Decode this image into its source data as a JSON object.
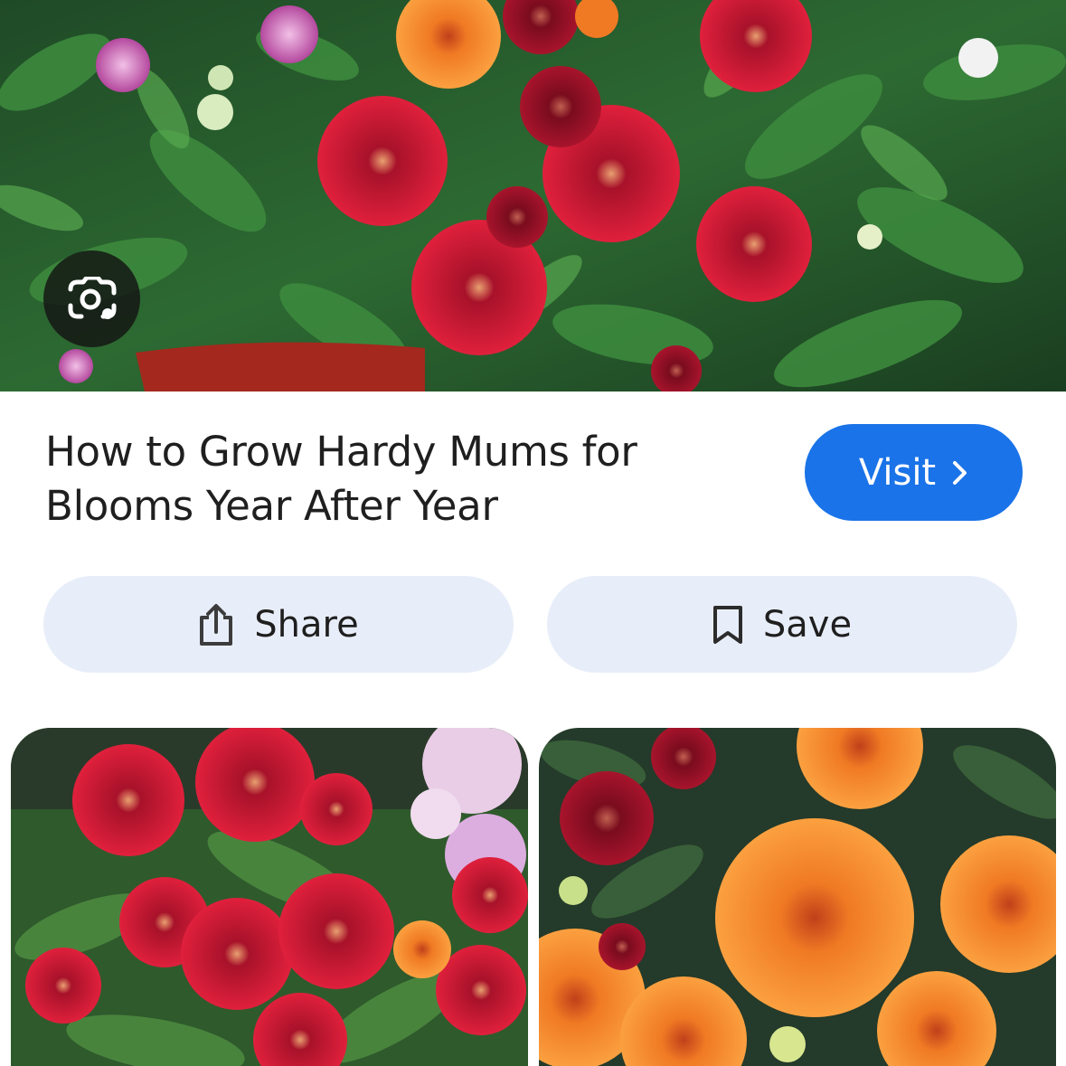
{
  "hero": {
    "image_alt": "Red and pink hardy mums growing among green leaves"
  },
  "lens": {
    "icon": "google-lens-icon"
  },
  "result": {
    "title": "How to Grow Hardy Mums for Blooms Year After Year"
  },
  "buttons": {
    "visit_label": "Visit",
    "visit_icon": "chevron-right-icon",
    "share_label": "Share",
    "share_icon": "share-icon",
    "save_label": "Save",
    "save_icon": "bookmark-icon"
  },
  "related": [
    {
      "image_alt": "Deep red chrysanthemums with pink flowers behind"
    },
    {
      "image_alt": "Orange and yellow chrysanthemums"
    }
  ],
  "colors": {
    "accent_blue": "#1a73e8",
    "chip_background": "#e8eef9"
  }
}
